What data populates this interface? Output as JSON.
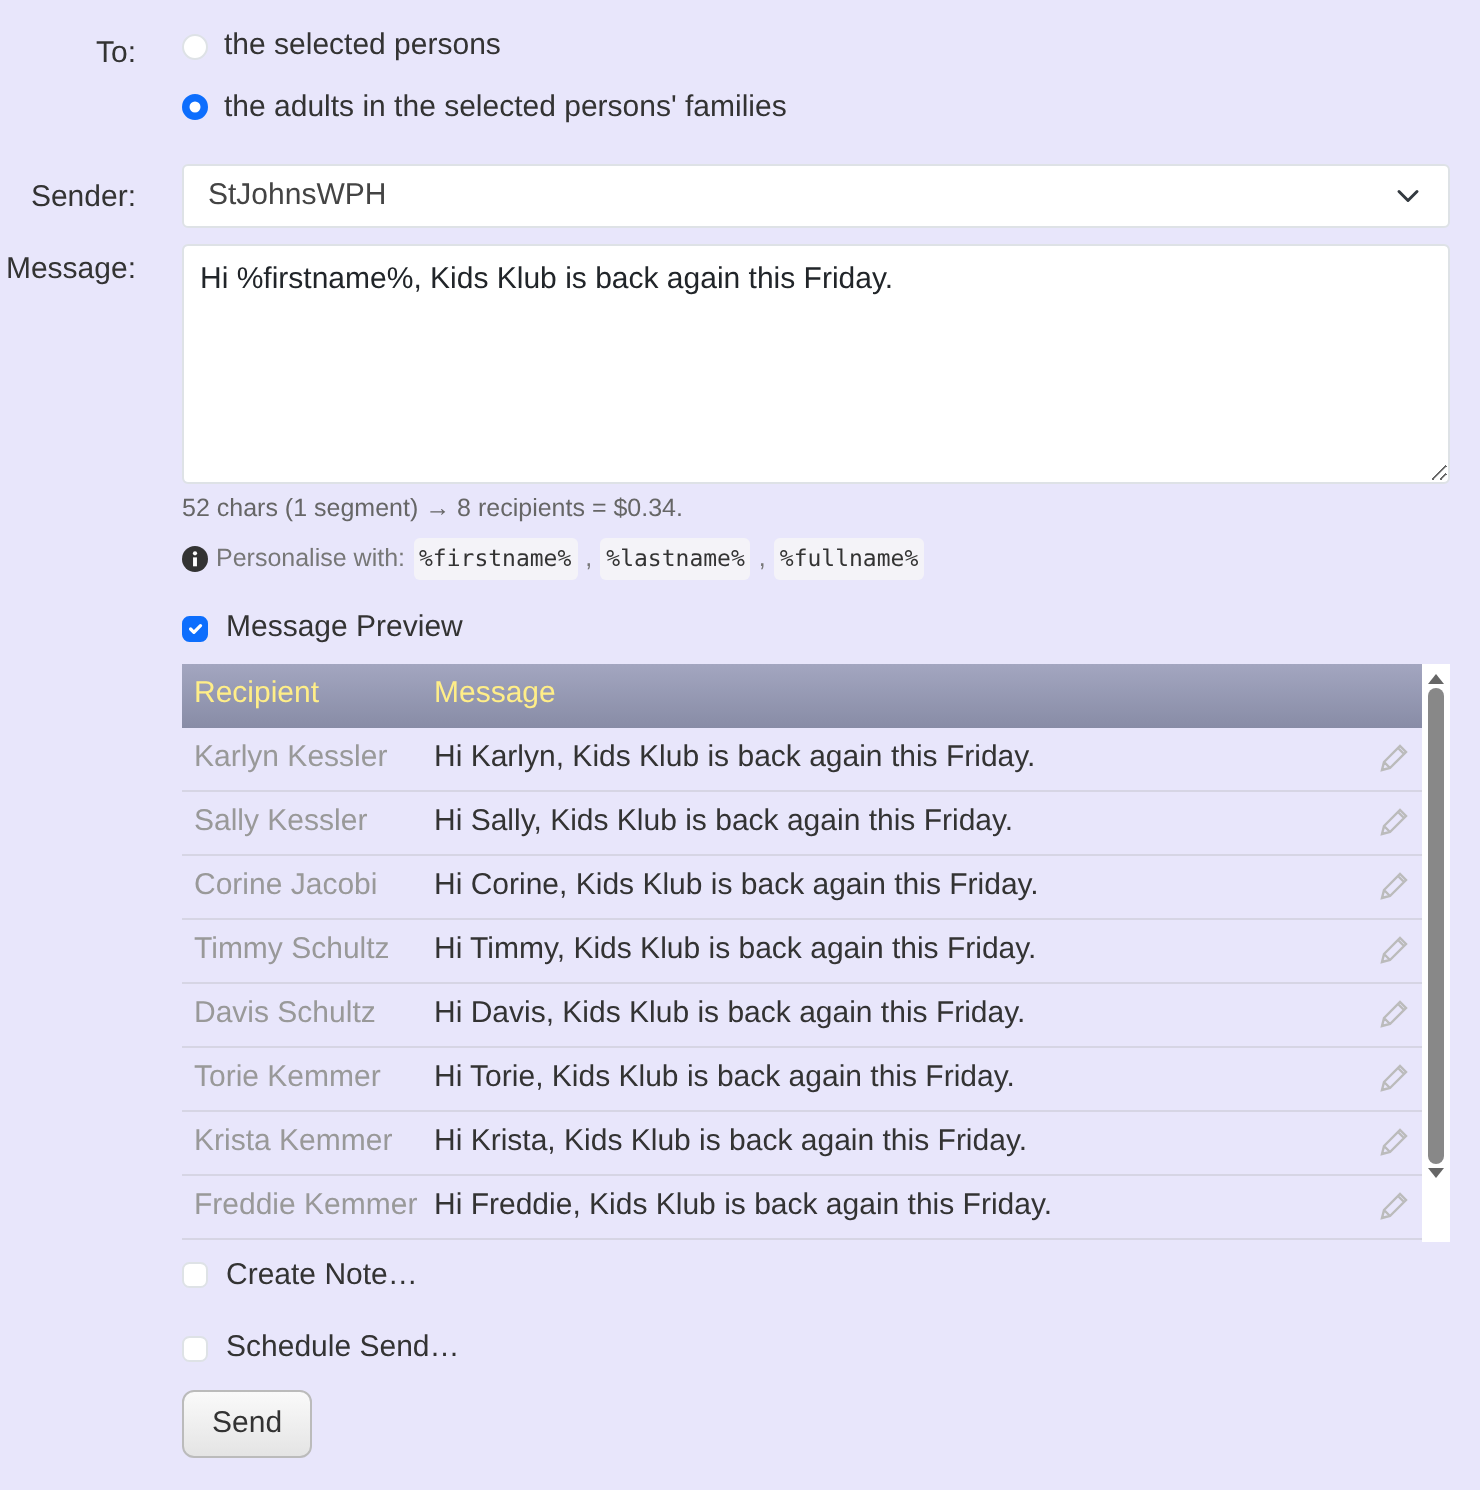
{
  "to": {
    "label": "To:",
    "options": [
      {
        "label": "the selected persons",
        "selected": false
      },
      {
        "label": "the adults in the selected persons' families",
        "selected": true
      }
    ]
  },
  "sender": {
    "label": "Sender:",
    "value": "StJohnsWPH"
  },
  "message": {
    "label": "Message:",
    "value": "Hi %firstname%, Kids Klub is back again this Friday.",
    "stats": "52 chars (1 segment) → 8 recipients = $0.34.",
    "personalise_label": "Personalise with:",
    "tokens": [
      {
        "text": "%firstname%",
        "separator": ","
      },
      {
        "text": "%lastname%",
        "separator": ","
      },
      {
        "text": "%fullname%"
      }
    ]
  },
  "preview": {
    "label": "Message Preview",
    "checked": true,
    "columns": [
      "Recipient",
      "Message"
    ],
    "rows": [
      {
        "recipient": "Karlyn Kessler",
        "message": "Hi Karlyn, Kids Klub is back again this Friday."
      },
      {
        "recipient": "Sally Kessler",
        "message": "Hi Sally, Kids Klub is back again this Friday."
      },
      {
        "recipient": "Corine Jacobi",
        "message": "Hi Corine, Kids Klub is back again this Friday."
      },
      {
        "recipient": "Timmy Schultz",
        "message": "Hi Timmy, Kids Klub is back again this Friday."
      },
      {
        "recipient": "Davis Schultz",
        "message": "Hi Davis, Kids Klub is back again this Friday."
      },
      {
        "recipient": "Torie Kemmer",
        "message": "Hi Torie, Kids Klub is back again this Friday."
      },
      {
        "recipient": "Krista Kemmer",
        "message": "Hi Krista, Kids Klub is back again this Friday."
      },
      {
        "recipient": "Freddie Kemmer",
        "message": "Hi Freddie, Kids Klub is back again this Friday."
      }
    ]
  },
  "options": [
    {
      "label": "Create Note…",
      "checked": false
    },
    {
      "label": "Schedule Send…",
      "checked": false
    }
  ],
  "send_button": "Send"
}
